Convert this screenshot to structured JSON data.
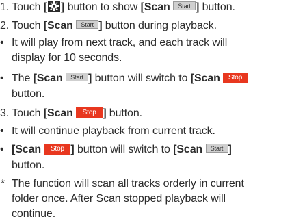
{
  "steps": [
    {
      "num": "1.",
      "text1": "Touch ",
      "bracket_l": "[",
      "bracket_r": "]",
      "text2": " button to show ",
      "scan_l": "[Scan ",
      "start": "Start",
      "scan_r": "]",
      "text3": " button."
    },
    {
      "num": "2.",
      "text1": "Touch ",
      "scan_l": "[Scan ",
      "start": "Start",
      "scan_r": "]",
      "text2": " button during playback."
    },
    {
      "bullet": "•",
      "l1": "It will play from next track, and each track will",
      "l2": "display for 10 seconds."
    },
    {
      "bullet": "•",
      "pre": "The ",
      "scan_l": "[Scan ",
      "start": "Start",
      "scan_r": "]",
      "mid": " button will switch to ",
      "scan_l2": "[Scan ",
      "stop": "Stop",
      "l2": "button."
    },
    {
      "num": "3.",
      "text1": "Touch ",
      "scan_l": "[Scan ",
      "stop": "Stop",
      "scan_r": "]",
      "text2": " button."
    },
    {
      "bullet": "•",
      "l1": "It will continue playback from current track."
    },
    {
      "bullet": "•",
      "scan_l": "[Scan ",
      "stop": "Stop",
      "scan_r": "]",
      "mid": " button will switch to ",
      "scan_l2": "[Scan ",
      "start": "Start",
      "scan_r2": "]",
      "l2": "button."
    },
    {
      "star": "*",
      "l1": "The function will scan all tracks orderly in current",
      "l2": "folder once. After Scan stopped playback will",
      "l3": "continue."
    }
  ],
  "icon": "settings-gear-icon",
  "colors": {
    "text": "#2b2b2b",
    "start_btn": "#cfcfcf",
    "stop_btn": "#e8371f"
  }
}
